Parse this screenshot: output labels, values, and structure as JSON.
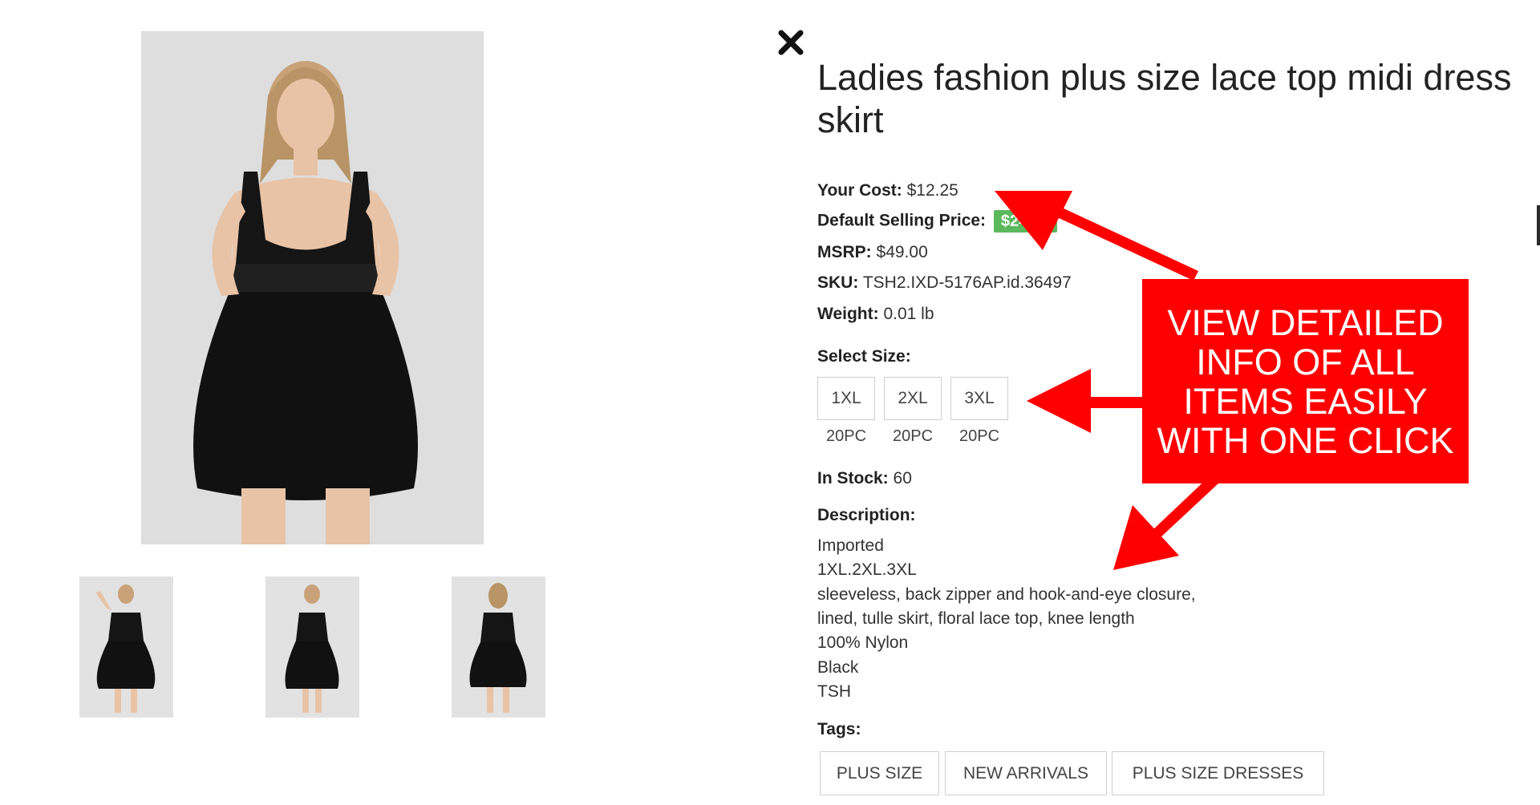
{
  "product": {
    "title_line1": "Ladies fashion plus size lace top midi dress",
    "title_line2": "skirt",
    "your_cost_label": "Your Cost:",
    "your_cost_value": "$12.25",
    "default_price_label": "Default Selling Price:",
    "default_price_value": "$24.50",
    "msrp_label": "MSRP:",
    "msrp_value": "$49.00",
    "sku_label": "SKU:",
    "sku_value": "TSH2.IXD-5176AP.id.36497",
    "weight_label": "Weight:",
    "weight_value": "0.01 lb",
    "select_size_label": "Select Size:",
    "sizes": [
      {
        "label": "1XL",
        "qty": "20PC"
      },
      {
        "label": "2XL",
        "qty": "20PC"
      },
      {
        "label": "3XL",
        "qty": "20PC"
      }
    ],
    "in_stock_label": "In Stock:",
    "in_stock_value": "60",
    "description_label": "Description:",
    "description_lines": [
      "Imported",
      "1XL.2XL.3XL",
      "sleeveless, back zipper and hook-and-eye closure,",
      "lined, tulle skirt, floral lace top, knee length",
      "100% Nylon",
      "Black",
      "TSH"
    ],
    "tags_label": "Tags:",
    "tags": [
      "PLUS SIZE",
      "NEW ARRIVALS",
      "PLUS SIZE DRESSES"
    ]
  },
  "callout": {
    "lines": [
      "VIEW DETAILED",
      "INFO OF ALL",
      "ITEMS EASILY",
      "WITH ONE CLICK"
    ]
  },
  "icons": {
    "close": "close-icon",
    "main_photo": "dress-photo",
    "thumbnails": [
      "thumbnail-front",
      "thumbnail-front-side",
      "thumbnail-back"
    ]
  },
  "colors": {
    "price_badge": "#5cb85c",
    "callout": "#ff0000",
    "dress": "#111111",
    "photo_bg": "#dcdcdc"
  }
}
